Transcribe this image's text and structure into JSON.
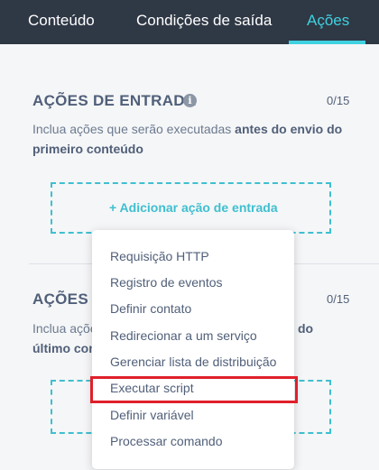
{
  "tabs": {
    "content": "Conteúdo",
    "exit_conditions": "Condições de saída",
    "actions": "Ações"
  },
  "entry_actions": {
    "title": "AÇÕES DE ENTRADA",
    "info_icon": "i",
    "counter": "0/15",
    "desc_prefix": "Inclua ações que serão executadas ",
    "desc_bold": "antes do envio do primeiro conteúdo",
    "add_label": "+ Adicionar ação de entrada"
  },
  "exit_actions": {
    "title_visible": "AÇÕES D",
    "counter": "0/15",
    "desc_line1_prefix": "Inclua açõe",
    "desc_line1_bold_suffix": "do",
    "desc_line2_bold": "último con"
  },
  "menu": {
    "items": [
      "Requisição HTTP",
      "Registro de eventos",
      "Definir contato",
      "Redirecionar a um serviço",
      "Gerenciar lista de distribuição",
      "Executar script",
      "Definir variável",
      "Processar comando"
    ]
  },
  "colors": {
    "header_bg": "#2f3845",
    "accent": "#3fd1e0",
    "highlight": "#e0202a"
  }
}
